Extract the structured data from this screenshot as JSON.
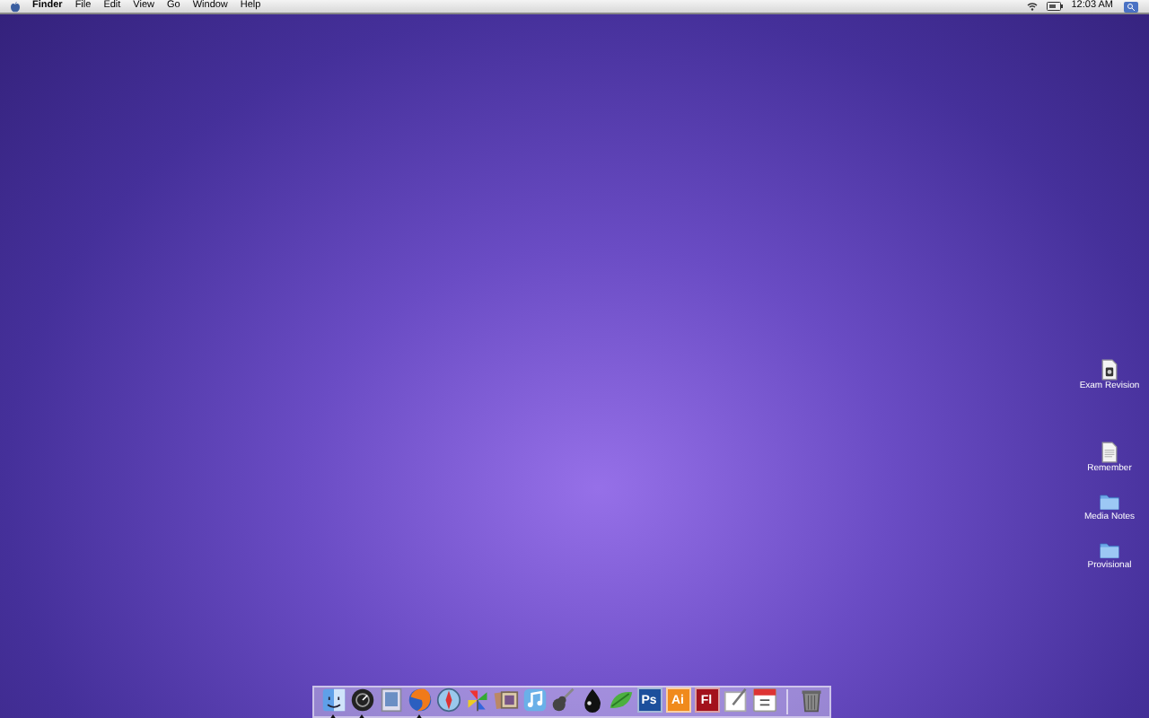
{
  "menu_bar": {
    "app": "Finder",
    "items": [
      "File",
      "Edit",
      "View",
      "Go",
      "Window",
      "Help"
    ],
    "clock": "12:03 AM"
  },
  "desktop_icons": [
    {
      "label": "Exam Revision",
      "kind": "document"
    },
    {
      "label": "Remember",
      "kind": "text"
    },
    {
      "label": "Media Notes",
      "kind": "folder"
    },
    {
      "label": "Provisional",
      "kind": "folder"
    }
  ],
  "dock": [
    {
      "kind": "face",
      "running": true
    },
    {
      "kind": "gauge",
      "running": true
    },
    {
      "kind": "photo",
      "running": false
    },
    {
      "kind": "fox",
      "running": true
    },
    {
      "kind": "compass",
      "running": false
    },
    {
      "kind": "pinwheel",
      "running": false
    },
    {
      "kind": "collage",
      "running": false
    },
    {
      "kind": "note",
      "running": false
    },
    {
      "kind": "guitar",
      "running": false
    },
    {
      "kind": "ink",
      "running": false
    },
    {
      "kind": "leaf",
      "running": false
    },
    {
      "kind": "tile",
      "label": "Ps",
      "color": "#1c4f9c"
    },
    {
      "kind": "tile",
      "label": "Ai",
      "color": "#f08a1c"
    },
    {
      "kind": "tile",
      "label": "Fl",
      "color": "#a3121c"
    },
    {
      "kind": "paper",
      "running": false
    },
    {
      "kind": "calendar",
      "running": false
    },
    {
      "kind": "trash",
      "running": false
    }
  ]
}
